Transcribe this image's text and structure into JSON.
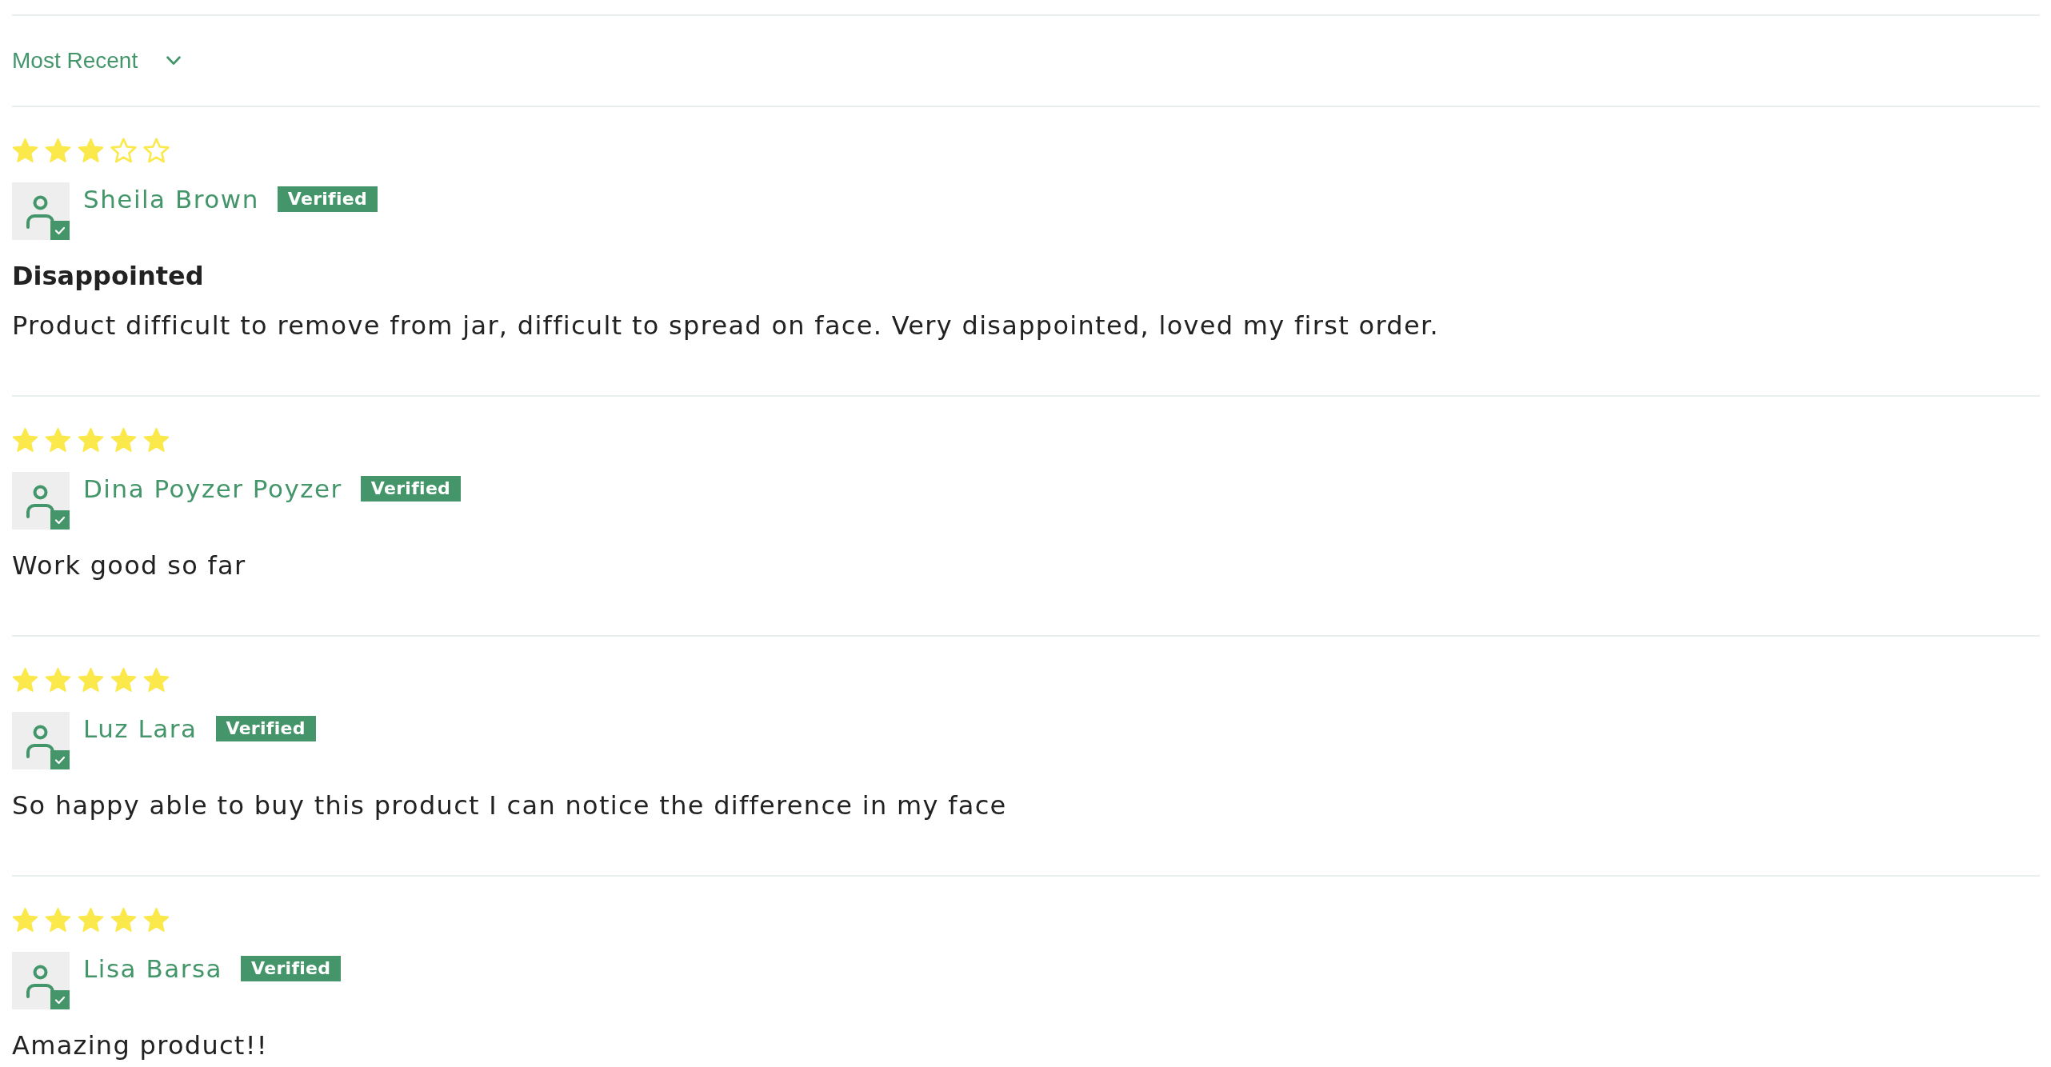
{
  "sort_dropdown": {
    "value": "Most Recent"
  },
  "reviews": [
    {
      "stars": 3,
      "author": "Sheila Brown",
      "badge": "Verified",
      "title": "Disappointed",
      "body": "Product difficult to remove from jar, difficult to spread on face. Very disappointed, loved my first order."
    },
    {
      "stars": 5,
      "author": "Dina Poyzer Poyzer",
      "badge": "Verified",
      "body": "Work good so far"
    },
    {
      "stars": 5,
      "author": "Luz Lara",
      "badge": "Verified",
      "body": "So happy able to buy this product I can notice the difference in my face"
    },
    {
      "stars": 5,
      "author": "Lisa Barsa",
      "badge": "Verified",
      "body": "Amazing product!!"
    }
  ]
}
